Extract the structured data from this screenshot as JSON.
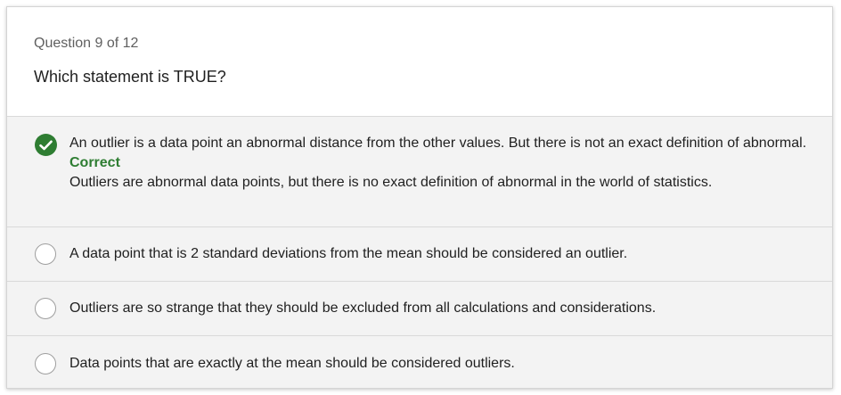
{
  "question": {
    "counter": "Question 9 of 12",
    "prompt": "Which statement is TRUE?"
  },
  "options": [
    {
      "text": "An outlier is a data point an abnormal distance from the other values. But there is not an exact definition of abnormal.",
      "selected": true,
      "result": "Correct",
      "feedback": "Outliers are abnormal data points, but there is no exact definition of abnormal in the world of statistics."
    },
    {
      "text": "A data point that is 2 standard deviations from the mean should be considered an outlier.",
      "selected": false
    },
    {
      "text": "Outliers are so strange that they should be excluded from all calculations and considerations.",
      "selected": false
    },
    {
      "text": "Data points that are exactly at the mean should be considered outliers.",
      "selected": false
    }
  ],
  "colors": {
    "correct": "#2e7d32",
    "option_bg": "#f3f3f3",
    "border": "#d9d9d9"
  },
  "icons": {
    "selected": "checkmark-circle-icon",
    "unselected": "radio-circle-icon"
  }
}
